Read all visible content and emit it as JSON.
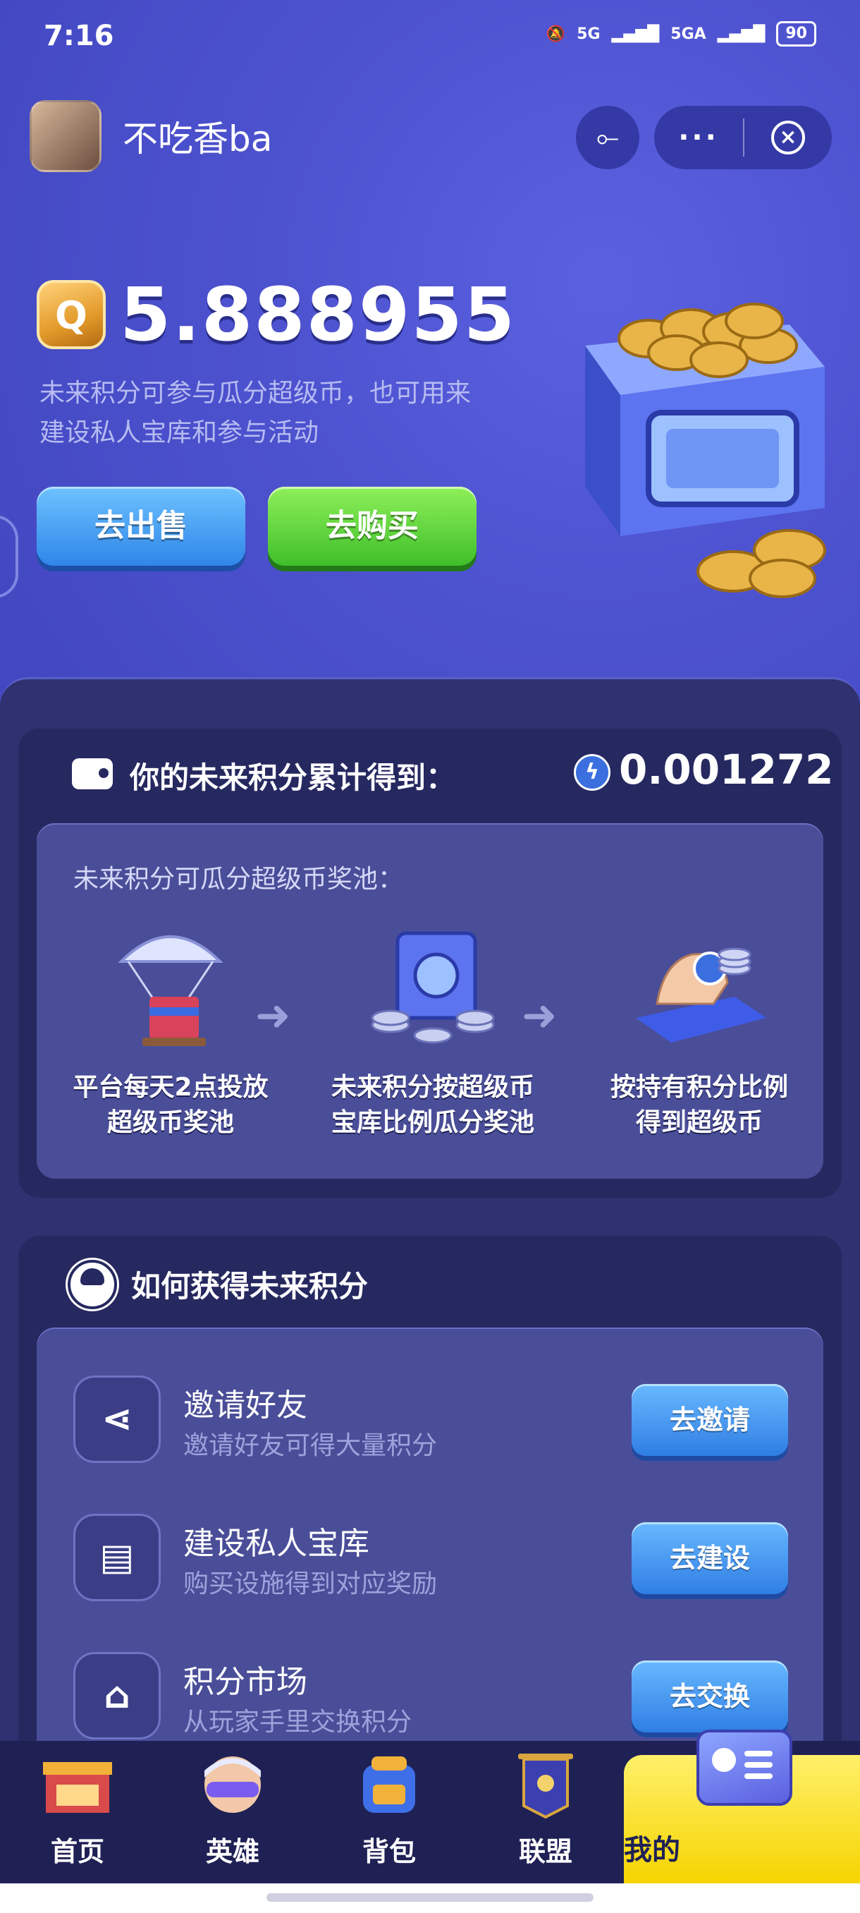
{
  "status_bar": {
    "time": "7:16",
    "net1": "5G",
    "net2": "5GA",
    "battery": "90"
  },
  "header": {
    "username": "不吃香ba",
    "more_label": "···",
    "close_label": "×"
  },
  "hero": {
    "coin_symbol": "Q",
    "balance": "5.888955",
    "description": "未来积分可参与瓜分超级币，也可用来建设私人宝库和参与活动",
    "sell_button": "去出售",
    "buy_button": "去购买"
  },
  "earnings_card": {
    "title": "你的未来积分累计得到：",
    "amount": "0.001272",
    "pool_title": "未来积分可瓜分超级币奖池：",
    "steps": [
      {
        "text": "平台每天2点投放\n超级币奖池"
      },
      {
        "text": "未来积分按超级币\n宝库比例瓜分奖池"
      },
      {
        "text": "按持有积分比例\n得到超级币"
      }
    ]
  },
  "how_card": {
    "title": "如何获得未来积分",
    "tasks": [
      {
        "title": "邀请好友",
        "subtitle": "邀请好友可得大量积分",
        "button": "去邀请",
        "icon": "share-icon"
      },
      {
        "title": "建设私人宝库",
        "subtitle": "购买设施得到对应奖励",
        "button": "去建设",
        "icon": "build-icon"
      },
      {
        "title": "积分市场",
        "subtitle": "从玩家手里交换积分",
        "button": "去交换",
        "icon": "market-icon"
      }
    ]
  },
  "tabbar": {
    "items": [
      {
        "label": "首页",
        "icon": "shop-icon"
      },
      {
        "label": "英雄",
        "icon": "hero-icon"
      },
      {
        "label": "背包",
        "icon": "backpack-icon"
      },
      {
        "label": "联盟",
        "icon": "banner-icon"
      },
      {
        "label": "我的",
        "icon": "profile-card-icon",
        "active": true
      }
    ]
  },
  "colors": {
    "bg": "#4b4fc9",
    "panel": "#2f3170",
    "accent_yellow": "#f5d400",
    "buy_green": "#3fbf2a",
    "sell_blue": "#2f86e8"
  }
}
